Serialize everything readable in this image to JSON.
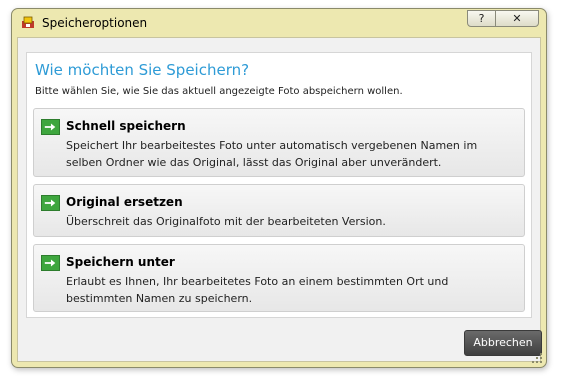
{
  "window": {
    "title": "Speicheroptionen",
    "help_label": "?",
    "close_label": "✕"
  },
  "dialog": {
    "heading": "Wie möchten Sie Speichern?",
    "subheading": "Bitte wählen Sie, wie Sie das aktuell angezeigte Foto abspeichern wollen.",
    "options": [
      {
        "title": "Schnell speichern",
        "description": "Speichert Ihr bearbeitestes Foto unter automatisch vergebenen Namen im selben Ordner wie das Original, lässt das Original aber unverändert."
      },
      {
        "title": "Original ersetzen",
        "description": "Überschreit das Originalfoto mit der bearbeiteten Version."
      },
      {
        "title": "Speichern unter",
        "description": "Erlaubt es Ihnen, Ihr bearbeitetes Foto an einem bestimmten Ort und bestimmten Namen zu speichern."
      }
    ],
    "cancel_label": "Abbrechen"
  },
  "colors": {
    "frame": "#ede8b0",
    "heading": "#2e9bd6",
    "arrow": "#3ea63e",
    "cancel_button": "#4a4a4a"
  },
  "icons": [
    "app-icon",
    "help-icon",
    "close-icon",
    "arrow-right-icon",
    "resize-grip-icon"
  ]
}
